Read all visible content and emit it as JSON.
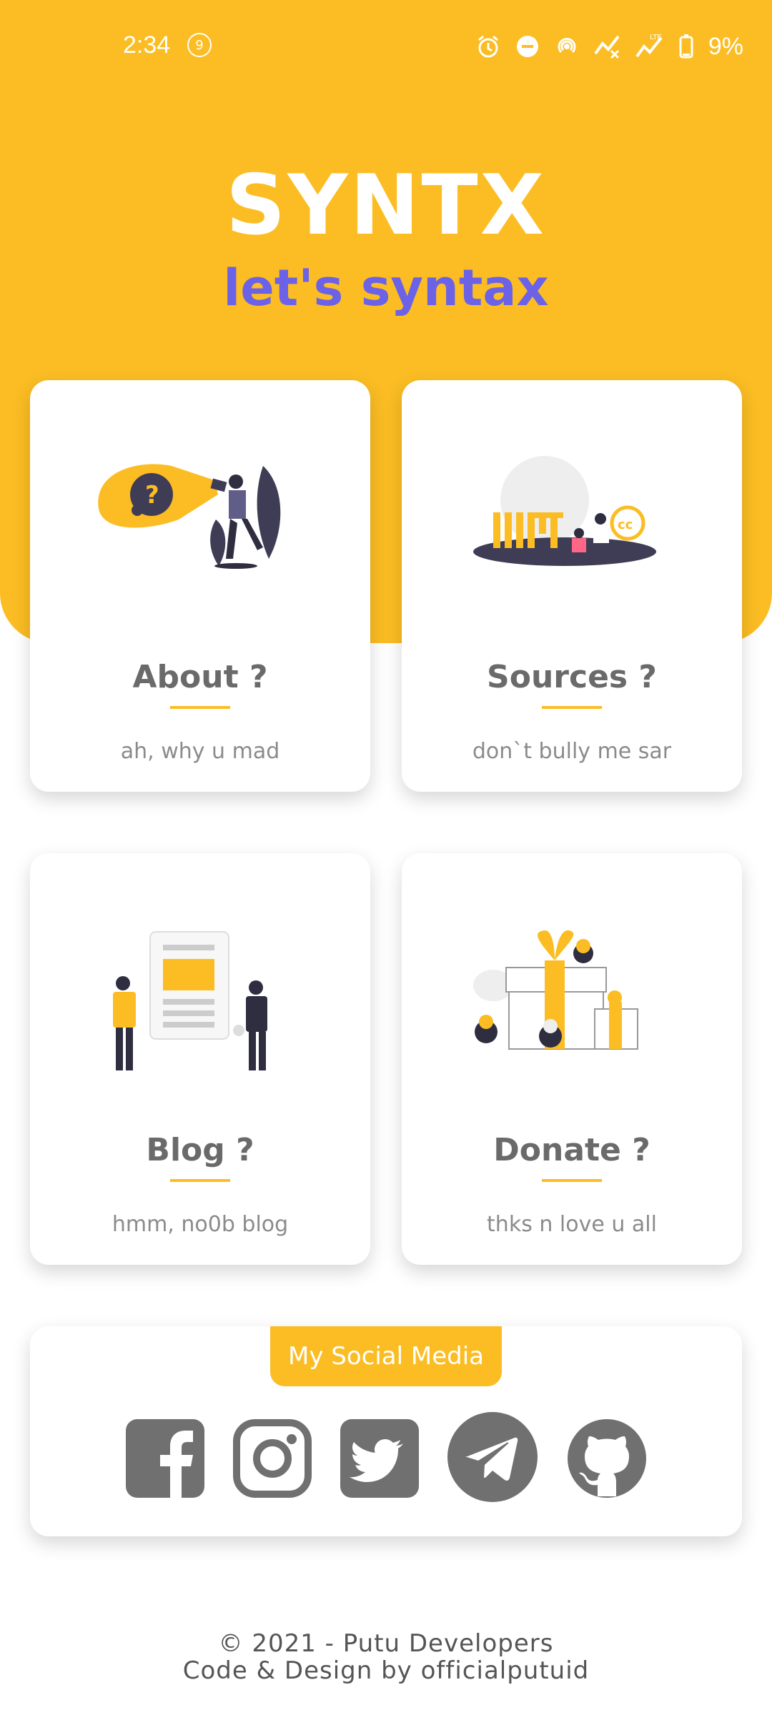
{
  "status_bar": {
    "time": "2:34",
    "notification_count": "9",
    "battery": "9%",
    "icons": [
      "alarm-icon",
      "do-not-disturb-icon",
      "hotspot-icon",
      "signal-icon",
      "lte-signal-icon",
      "battery-icon"
    ]
  },
  "header": {
    "title": "SYNTX",
    "tagline": "let's syntax",
    "background_color": "#fbbd23",
    "tagline_color": "#6b62e8"
  },
  "cards": [
    {
      "title": "About ?",
      "subtitle": "ah, why u mad",
      "illustration": "question-illustration"
    },
    {
      "title": "Sources ?",
      "subtitle": "don`t bully me sar",
      "illustration": "mit-license-illustration"
    },
    {
      "title": "Blog ?",
      "subtitle": "hmm, no0b blog",
      "illustration": "blog-illustration"
    },
    {
      "title": "Donate ?",
      "subtitle": "thks n love u all",
      "illustration": "gifts-illustration"
    }
  ],
  "social": {
    "label": "My Social Media",
    "items": [
      "facebook-icon",
      "instagram-icon",
      "twitter-icon",
      "telegram-icon",
      "github-icon"
    ]
  },
  "footer": {
    "copyright": "© 2021 - Putu Developers",
    "credit": "Code & Design by officialputuid"
  }
}
